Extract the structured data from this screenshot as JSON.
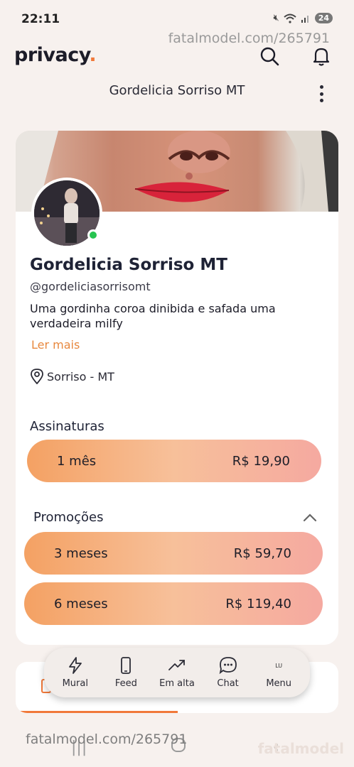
{
  "status": {
    "time": "22:11",
    "battery": "24"
  },
  "watermark": {
    "top": "fatalmodel.com/265791",
    "bottom": "fatalmodel.com/265791",
    "logo": "fatalmodel"
  },
  "header": {
    "logo": "privacy",
    "logo_dot": ".",
    "title": "Gordelicia Sorriso MT"
  },
  "profile": {
    "name": "Gordelicia Sorriso MT",
    "handle": "@gordeliciasorrisomt",
    "bio": "Uma gordinha coroa dinibida e safada uma verdadeira milfy",
    "read_more": "Ler mais",
    "location": "Sorriso - MT",
    "online": true
  },
  "subscriptions": {
    "title": "Assinaturas",
    "plans": [
      {
        "period": "1 mês",
        "price": "R$ 19,90"
      }
    ]
  },
  "promotions": {
    "title": "Promoções",
    "plans": [
      {
        "period": "3 meses",
        "price": "R$ 59,70"
      },
      {
        "period": "6 meses",
        "price": "R$ 119,40"
      }
    ]
  },
  "bottom_nav": {
    "items": [
      {
        "label": "Mural",
        "icon": "lightning-icon"
      },
      {
        "label": "Feed",
        "icon": "phone-icon"
      },
      {
        "label": "Em alta",
        "icon": "trending-icon"
      },
      {
        "label": "Chat",
        "icon": "chat-bubble-icon"
      },
      {
        "label": "Menu",
        "icon": "avatar-initials",
        "badge": "LU"
      }
    ]
  },
  "colors": {
    "accent": "#f1793a",
    "online": "#27c450",
    "plan_start": "#f4a163",
    "plan_end": "#f5a9a0"
  }
}
